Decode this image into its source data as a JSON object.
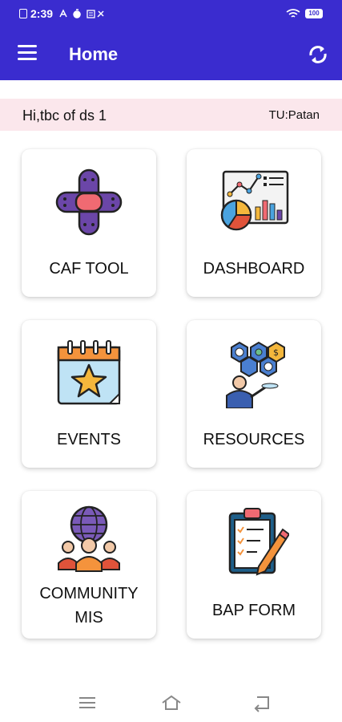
{
  "status_bar": {
    "time": "2:39",
    "battery": "100"
  },
  "app_bar": {
    "title": "Home"
  },
  "user_bar": {
    "greeting": "Hi,tbc of ds 1",
    "tu": "TU:Patan"
  },
  "tiles": [
    {
      "label": "CAF TOOL",
      "icon": "bandage-icon"
    },
    {
      "label": "DASHBOARD",
      "icon": "analytics-icon"
    },
    {
      "label": "EVENTS",
      "icon": "calendar-star-icon"
    },
    {
      "label": "RESOURCES",
      "icon": "resources-network-icon"
    },
    {
      "label_line1": "COMMUNITY",
      "label_line2": "MIS",
      "icon": "community-globe-icon"
    },
    {
      "label": "BAP FORM",
      "icon": "clipboard-checklist-icon"
    }
  ],
  "colors": {
    "app_bar": "#3a2ccf",
    "user_bar": "#fbe7ec"
  }
}
